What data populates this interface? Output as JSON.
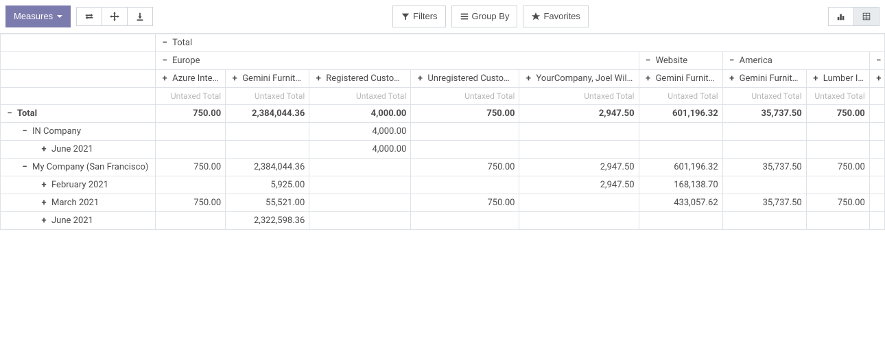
{
  "toolbar": {
    "measures_label": "Measures",
    "filters_label": "Filters",
    "group_by_label": "Group By",
    "favorites_label": "Favorites"
  },
  "hdr": {
    "total": "Total",
    "europe": "Europe",
    "website": "Website",
    "america": "America",
    "c0": "Azure Interior",
    "c1": "Gemini Furniture",
    "c2": "Registered Customer",
    "c3": "Unregistered Customer",
    "c4": "YourCompany, Joel Willis",
    "c5": "Gemini Furniture",
    "c6": "Gemini Furniture",
    "c7": "Lumber Inc",
    "measure": "Untaxed Total"
  },
  "rows": {
    "total": {
      "label": "Total",
      "c0": "750.00",
      "c1": "2,384,044.36",
      "c2": "4,000.00",
      "c3": "750.00",
      "c4": "2,947.50",
      "c5": "601,196.32",
      "c6": "35,737.50",
      "c7": "750.00"
    },
    "in_company": {
      "label": "IN Company",
      "c2": "4,000.00"
    },
    "in_jun21": {
      "label": "June 2021",
      "c2": "4,000.00"
    },
    "my_company": {
      "label": "My Company (San Francisco)",
      "c0": "750.00",
      "c1": "2,384,044.36",
      "c3": "750.00",
      "c4": "2,947.50",
      "c5": "601,196.32",
      "c6": "35,737.50",
      "c7": "750.00"
    },
    "feb21": {
      "label": "February 2021",
      "c1": "5,925.00",
      "c4": "2,947.50",
      "c5": "168,138.70"
    },
    "mar21": {
      "label": "March 2021",
      "c0": "750.00",
      "c1": "55,521.00",
      "c3": "750.00",
      "c5": "433,057.62",
      "c6": "35,737.50",
      "c7": "750.00"
    },
    "jun21": {
      "label": "June 2021",
      "c1": "2,322,598.36"
    }
  }
}
